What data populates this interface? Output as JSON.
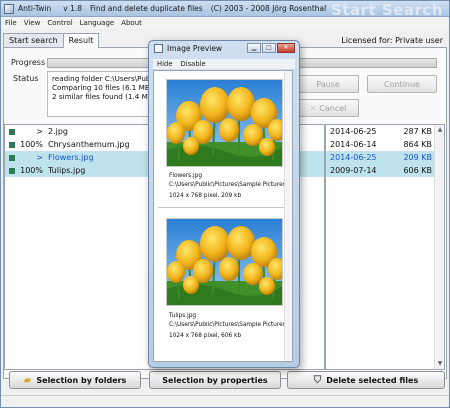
{
  "window": {
    "app_name": "Anti-Twin",
    "version": "v 1.8",
    "subtitle": "Find and delete duplicate files",
    "copyright": "(C) 2003 - 2008  Jörg Rosenthal",
    "ghost_title": "Start Search"
  },
  "menu": [
    "File",
    "View",
    "Control",
    "Language",
    "About"
  ],
  "tabs": [
    {
      "label": "Start search",
      "active": false
    },
    {
      "label": "Result",
      "active": true
    }
  ],
  "licensed": "Licensed for: Private user",
  "progress": {
    "label": "Progress"
  },
  "status": {
    "label": "Status",
    "lines": [
      "reading folder C:\\Users\\Publ",
      "Comparing 10 files (6.1 MB",
      "2 similar files found (1.4 MB"
    ]
  },
  "buttons": {
    "pause": "Pause",
    "continue": "Continue",
    "cancel": "Cancel"
  },
  "files": [
    {
      "mark": ">",
      "name": "2.jpg",
      "date": "2014-06-25",
      "size": "287 KB",
      "highlight": false
    },
    {
      "mark": "100%",
      "name": "Chrysanthemum.jpg",
      "date": "2014-06-14",
      "size": "864 KB",
      "highlight": false
    },
    {
      "mark": ">",
      "name": "Flowers.jpg",
      "date": "2014-06-25",
      "size": "209 KB",
      "highlight": true
    },
    {
      "mark": "100%",
      "name": "Tulips.jpg",
      "date": "2009-07-14",
      "size": "606 KB",
      "highlight": true
    }
  ],
  "bottom_buttons": {
    "by_folders": "Selection by folders",
    "by_properties": "Selection by properties",
    "delete": "Delete selected files"
  },
  "preview": {
    "title": "Image Preview",
    "menu": [
      "Hide",
      "Disable"
    ],
    "items": [
      {
        "name": "Flowers.jpg",
        "path": "C:\\Users\\Public\\Pictures\\Sample Pictures\\",
        "info": "1024 x 768 pixel, 209 kb"
      },
      {
        "name": "Tulips.jpg",
        "path": "C:\\Users\\Public\\Pictures\\Sample Pictures\\",
        "info": "1024 x 768 pixel, 606 kb"
      }
    ]
  },
  "icons": {
    "folder": "folder-icon",
    "shield": "shield-icon",
    "cancel": "cancel-x-icon"
  }
}
